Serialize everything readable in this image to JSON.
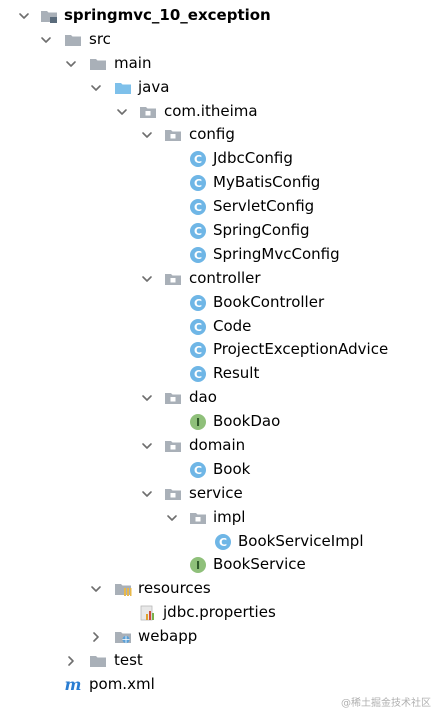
{
  "project_tree": {
    "root": {
      "label": "springmvc_10_exception",
      "expanded": true,
      "icon": "module-folder-icon"
    },
    "src": {
      "label": "src",
      "expanded": true,
      "icon": "folder-icon"
    },
    "main": {
      "label": "main",
      "expanded": true,
      "icon": "folder-icon"
    },
    "java": {
      "label": "java",
      "expanded": true,
      "icon": "source-root-folder-icon"
    },
    "package": {
      "label": "com.itheima",
      "expanded": true,
      "icon": "package-icon"
    },
    "config": {
      "label": "config",
      "expanded": true,
      "icon": "package-icon",
      "items": [
        {
          "label": "JdbcConfig",
          "icon": "class-icon"
        },
        {
          "label": "MyBatisConfig",
          "icon": "class-icon"
        },
        {
          "label": "ServletConfig",
          "icon": "class-icon"
        },
        {
          "label": "SpringConfig",
          "icon": "class-icon"
        },
        {
          "label": "SpringMvcConfig",
          "icon": "class-icon"
        }
      ]
    },
    "controller": {
      "label": "controller",
      "expanded": true,
      "icon": "package-icon",
      "items": [
        {
          "label": "BookController",
          "icon": "class-icon"
        },
        {
          "label": "Code",
          "icon": "class-icon"
        },
        {
          "label": "ProjectExceptionAdvice",
          "icon": "class-icon"
        },
        {
          "label": "Result",
          "icon": "class-icon"
        }
      ]
    },
    "dao": {
      "label": "dao",
      "expanded": true,
      "icon": "package-icon",
      "items": [
        {
          "label": "BookDao",
          "icon": "interface-icon"
        }
      ]
    },
    "domain": {
      "label": "domain",
      "expanded": true,
      "icon": "package-icon",
      "items": [
        {
          "label": "Book",
          "icon": "class-icon"
        }
      ]
    },
    "service": {
      "label": "service",
      "expanded": true,
      "icon": "package-icon",
      "impl": {
        "label": "impl",
        "expanded": true,
        "icon": "package-icon",
        "items": [
          {
            "label": "BookServiceImpl",
            "icon": "class-icon"
          }
        ]
      },
      "items": [
        {
          "label": "BookService",
          "icon": "interface-icon"
        }
      ]
    },
    "resources": {
      "label": "resources",
      "expanded": true,
      "icon": "resources-folder-icon",
      "items": [
        {
          "label": "jdbc.properties",
          "icon": "properties-file-icon"
        }
      ]
    },
    "webapp": {
      "label": "webapp",
      "expanded": false,
      "icon": "web-folder-icon"
    },
    "test": {
      "label": "test",
      "expanded": false,
      "icon": "folder-icon"
    },
    "pom": {
      "label": "pom.xml",
      "icon": "maven-icon"
    }
  },
  "watermark": "@稀土掘金技术社区",
  "colors": {
    "chevron": "#6e6e6e",
    "folder": "#a9b0b8",
    "source_folder": "#7ec0ea",
    "class_badge_fill": "#6fb6e6",
    "class_badge_text": "#ffffff",
    "interface_badge_fill": "#8fc07a",
    "interface_badge_text": "#2f5a2a",
    "maven_m": "#2a7dd2"
  }
}
